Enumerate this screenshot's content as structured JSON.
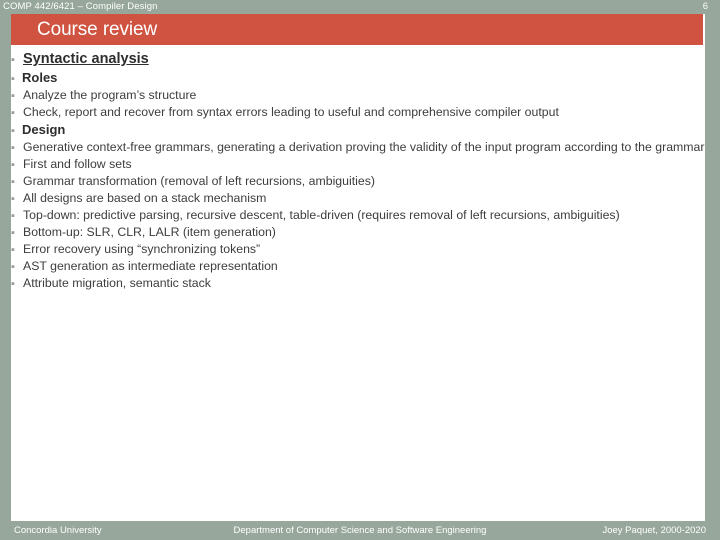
{
  "header": {
    "course_label": "COMP 442/6421 – Compiler Design",
    "page_number": "6",
    "band_color": "#97a79b"
  },
  "title": {
    "text": "Course review",
    "bar_color": "#cf5340",
    "text_color": "#ffffff"
  },
  "bullet_glyph": "▪",
  "content": {
    "section": {
      "label": "Syntactic analysis",
      "groups": [
        {
          "label": "Roles",
          "items": [
            "Analyze the program’s structure",
            "Check, report and recover from syntax errors leading to useful and comprehensive compiler output"
          ]
        },
        {
          "label": "Design",
          "items": [
            "Generative context-free grammars, generating a derivation proving the validity of the input program according to the grammar",
            "First and follow sets",
            "Grammar transformation (removal of left recursions, ambiguities)",
            "All designs are based on a stack mechanism",
            "Top-down: predictive parsing, recursive descent, table-driven (requires removal of left recursions, ambiguities)",
            "Bottom-up: SLR, CLR, LALR (item generation)",
            "Error recovery using “synchronizing tokens”",
            "AST generation as intermediate representation",
            "Attribute migration, semantic stack"
          ]
        }
      ]
    }
  },
  "footer": {
    "left": "Concordia University",
    "center": "Department of Computer Science and Software Engineering",
    "right": "Joey Paquet, 2000-2020"
  }
}
